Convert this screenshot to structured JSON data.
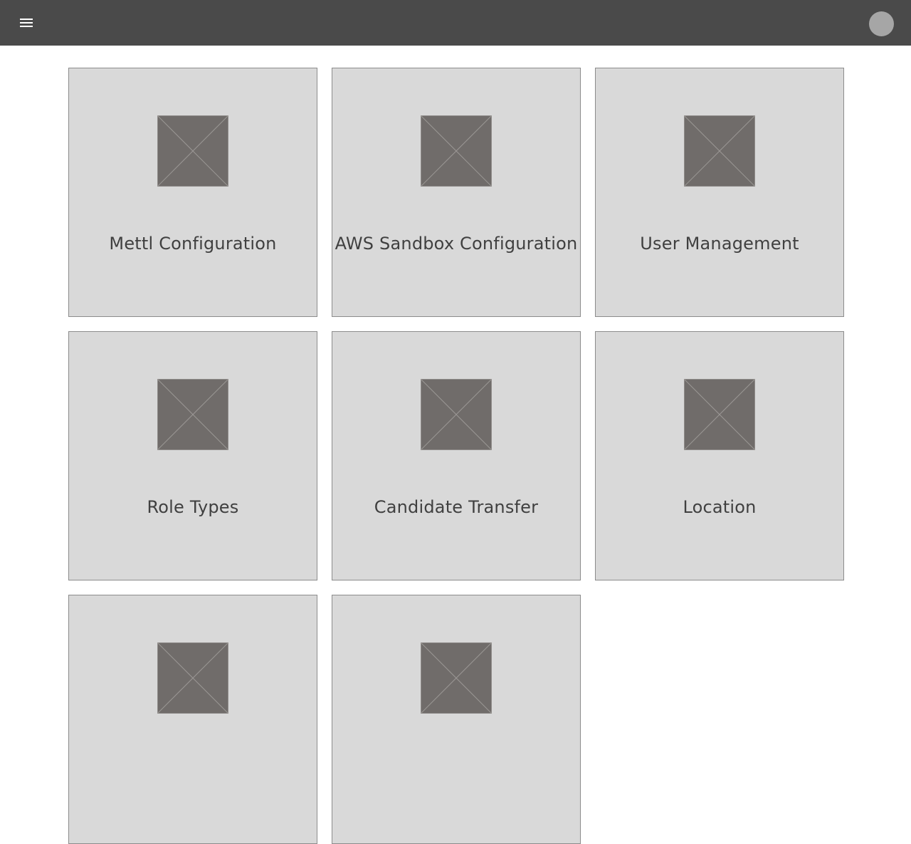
{
  "header": {
    "menu_icon": "hamburger-menu-icon",
    "avatar_icon": "user-avatar-icon",
    "background_color": "#4a4a4a"
  },
  "tiles": [
    {
      "label": "Mettl Configuration",
      "icon": "image-placeholder-icon"
    },
    {
      "label": "AWS Sandbox Configuration",
      "icon": "image-placeholder-icon"
    },
    {
      "label": "User Management",
      "icon": "image-placeholder-icon"
    },
    {
      "label": "Role Types",
      "icon": "image-placeholder-icon"
    },
    {
      "label": "Candidate Transfer",
      "icon": "image-placeholder-icon"
    },
    {
      "label": "Location",
      "icon": "image-placeholder-icon"
    },
    {
      "label": "",
      "icon": "image-placeholder-icon"
    },
    {
      "label": "",
      "icon": "image-placeholder-icon"
    }
  ],
  "colors": {
    "tile_background": "#d9d9d9",
    "tile_border": "#8c8c8c",
    "placeholder_fill": "#706c6a",
    "label_text": "#404040"
  }
}
